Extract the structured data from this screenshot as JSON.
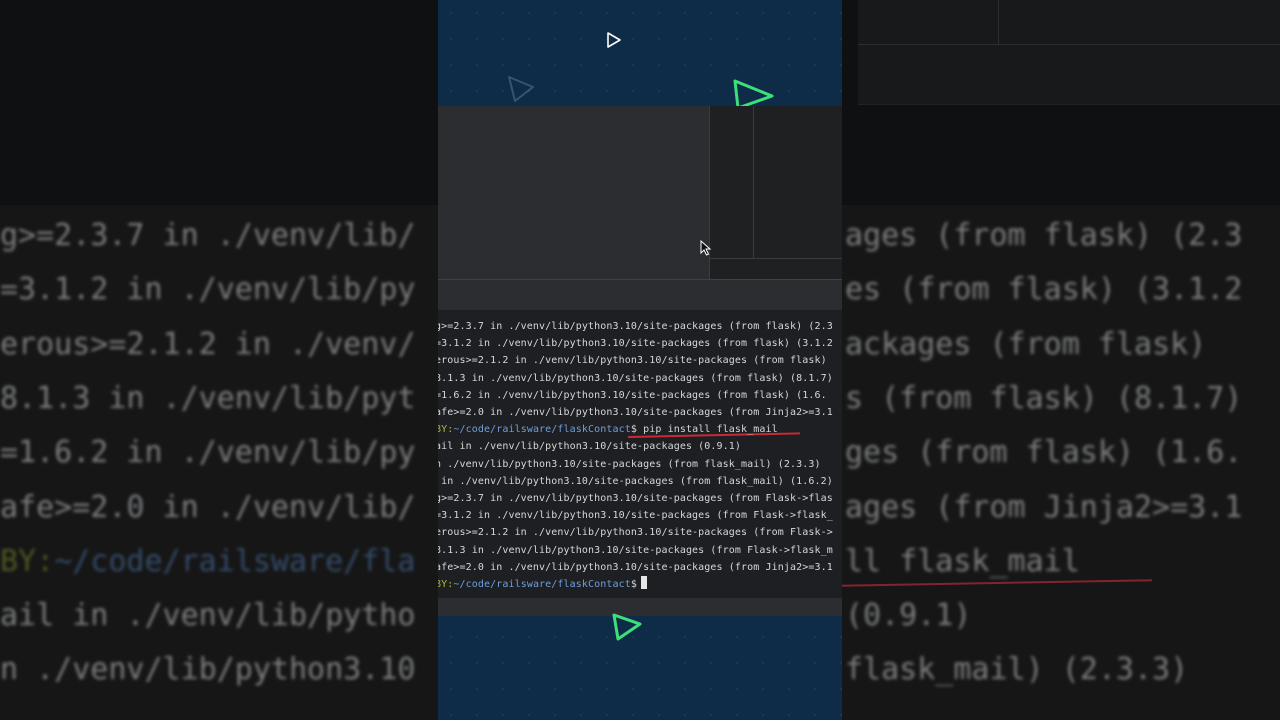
{
  "terminal": {
    "lines": [
      {
        "text": "g>=2.3.7 in ./venv/lib/python3.10/site-packages (from flask) (2.3"
      },
      {
        "text": "=3.1.2 in ./venv/lib/python3.10/site-packages (from flask) (3.1.2"
      },
      {
        "text": "erous>=2.1.2 in ./venv/lib/python3.10/site-packages (from flask)"
      },
      {
        "text": "8.1.3 in ./venv/lib/python3.10/site-packages (from flask) (8.1.7)"
      },
      {
        "text": "=1.6.2 in ./venv/lib/python3.10/site-packages (from flask) (1.6."
      },
      {
        "text": "afe>=2.0 in ./venv/lib/python3.10/site-packages (from Jinja2>=3.1"
      },
      {
        "user": "BY:",
        "path": "~/code/railsware/flaskContact",
        "cmd": "$ pip install flask_mail"
      },
      {
        "text": "ail in ./venv/lib/python3.10/site-packages (0.9.1)"
      },
      {
        "text": "n ./venv/lib/python3.10/site-packages (from flask_mail) (2.3.3)"
      },
      {
        "text": " in ./venv/lib/python3.10/site-packages (from flask_mail) (1.6.2)"
      },
      {
        "text": "g>=2.3.7 in ./venv/lib/python3.10/site-packages (from Flask->flas"
      },
      {
        "text": "=3.1.2 in ./venv/lib/python3.10/site-packages (from Flask->flask_"
      },
      {
        "text": "erous>=2.1.2 in ./venv/lib/python3.10/site-packages (from Flask->"
      },
      {
        "text": "8.1.3 in ./venv/lib/python3.10/site-packages (from Flask->flask_m"
      },
      {
        "text": "afe>=2.0 in ./venv/lib/python3.10/site-packages (from Jinja2>=3.1"
      },
      {
        "user": "BY:",
        "path": "~/code/railsware/flaskContact",
        "cmd": "$"
      }
    ]
  },
  "background_zoom": {
    "lines": [
      {
        "left": "g>=2.3.7 in ./venv/lib/",
        "right": "ages (from flask) (2.3"
      },
      {
        "left": "=3.1.2 in ./venv/lib/py",
        "right": "es (from flask) (3.1.2"
      },
      {
        "left": "erous>=2.1.2 in ./venv/",
        "right": "ackages (from flask)"
      },
      {
        "left": "8.1.3 in ./venv/lib/pyt",
        "right": "s (from flask) (8.1.7)"
      },
      {
        "left": "=1.6.2 in ./venv/lib/py",
        "right": "ges (from flask) (1.6."
      },
      {
        "left": "afe>=2.0 in ./venv/lib/",
        "right": "ages (from Jinja2>=3.1"
      },
      {
        "left_user": "BY:",
        "left_path": "~/code/railsware/fla",
        "right": "ll flask_mail"
      },
      {
        "left": "ail in ./venv/lib/pytho",
        "right": "(0.9.1)"
      },
      {
        "left": "n ./venv/lib/python3.10",
        "right": "flask_mail) (2.3.3)"
      },
      {
        "left": "",
        "right": ""
      }
    ]
  },
  "colors": {
    "strip_bg": "#0e2b47",
    "terminal_bg": "#1e1f22",
    "accent_green": "#3ce07a",
    "path_blue": "#6e9fdb",
    "user_green": "#a9b73e",
    "annotation_red": "#c62a37"
  },
  "icons": {
    "top": "play-icon",
    "decor1": "triangle-outline-icon",
    "decor2": "green-triangle-icon",
    "decor3": "green-triangle-icon",
    "mouse": "mouse-pointer-icon"
  }
}
